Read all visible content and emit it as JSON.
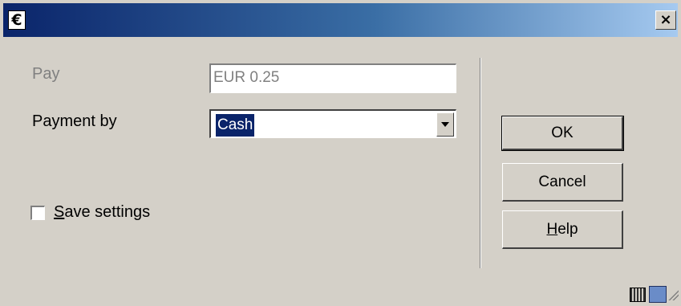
{
  "window": {
    "title_icon": "€",
    "close_glyph": "×"
  },
  "form": {
    "pay_label": "Pay",
    "pay_value": "EUR 0.25",
    "payment_by_label": "Payment by",
    "payment_by_value": "Cash",
    "save_settings_label": "Save settings",
    "save_settings_checked": false
  },
  "buttons": {
    "ok": "OK",
    "cancel": "Cancel",
    "help": "Help"
  },
  "statusbar": {
    "icons": [
      "keyboard-icon",
      "resize-icon",
      "size-grip-icon"
    ]
  },
  "colors": {
    "title_gradient_start": "#0a246a",
    "title_gradient_end": "#a6caf0",
    "dialog_background": "#d4d0c8",
    "selection": "#0a246a"
  }
}
